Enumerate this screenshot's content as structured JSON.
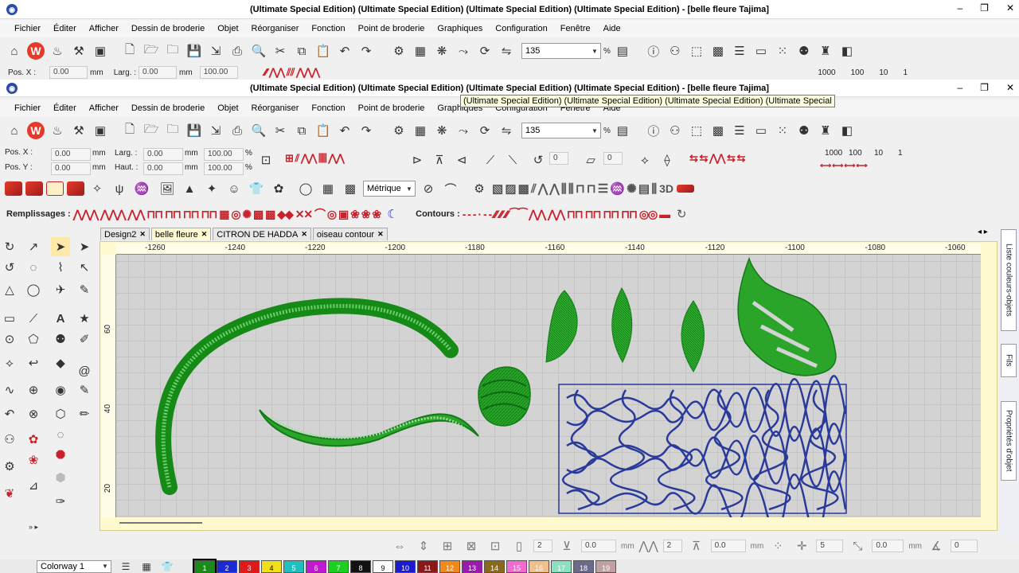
{
  "window": {
    "title": "(Ultimate Special Edition) (Ultimate Special Edition) (Ultimate Special Edition) (Ultimate Special Edition) - [belle fleure        Tajima]",
    "title2": "(Ultimate Special Edition) (Ultimate Special Edition) (Ultimate Special Edition) (Ultimate Special Edition) - [belle fleure        Tajima]",
    "minimize": "–",
    "restore": "❐",
    "close": "✕"
  },
  "menu": [
    "Fichier",
    "Éditer",
    "Afficher",
    "Dessin de broderie",
    "Objet",
    "Réorganiser",
    "Fonction",
    "Point de broderie",
    "Graphiques",
    "Configuration",
    "Fenêtre",
    "Aide"
  ],
  "toolbar": {
    "zoom": "135",
    "percent": "%",
    "units": "Métrique"
  },
  "position": {
    "pos_x_label": "Pos. X :",
    "pos_x": "0.00",
    "pos_y_label": "Pos. Y :",
    "pos_y": "0.00",
    "unit": "mm",
    "larg_label": "Larg. :",
    "larg": "0.00",
    "haut_label": "Haut. :",
    "haut": "0.00",
    "scale_x": "100.00",
    "scale_y": "100.00",
    "pct": "%",
    "rot1": "0",
    "rot2": "0"
  },
  "numbers": {
    "n1000": "1000",
    "n100": "100",
    "n10": "10",
    "n1": "1"
  },
  "fill_bar": {
    "remplissages": "Remplissages :",
    "contours": "Contours :"
  },
  "tabs": [
    {
      "label": "Design2"
    },
    {
      "label": "belle fleure"
    },
    {
      "label": "CITRON DE HADDA"
    },
    {
      "label": "oiseau contour"
    }
  ],
  "ruler": {
    "h": [
      "-1260",
      "-1240",
      "-1220",
      "-1200",
      "-1180",
      "-1160",
      "-1140",
      "-1120",
      "-1100",
      "-1080",
      "-1060"
    ],
    "v": [
      "60",
      "40",
      "20"
    ]
  },
  "tooltip": "(Ultimate Special Edition) (Ultimate Special Edition) (Ultimate Special Edition) (Ultimate Special",
  "right_panel": {
    "colors_tab": "Liste couleurs-objets",
    "threads_tab": "Fils",
    "props_tab": "Propriétés d'objet"
  },
  "bottom": {
    "v2": "2",
    "v00": "0.0",
    "mm": "mm",
    "v2b": "2",
    "v00b": "0.0",
    "mm2": "mm",
    "v5": "5",
    "v00c": "0.0",
    "mm3": "mm",
    "v0": "0"
  },
  "colorway": "Colorway 1",
  "palette": [
    {
      "n": "1",
      "c": "#1a8a1a"
    },
    {
      "n": "2",
      "c": "#1a2bd6"
    },
    {
      "n": "3",
      "c": "#e01a1a"
    },
    {
      "n": "4",
      "c": "#f0e01a"
    },
    {
      "n": "5",
      "c": "#20c0c0"
    },
    {
      "n": "6",
      "c": "#c01ad0"
    },
    {
      "n": "7",
      "c": "#1ad020"
    },
    {
      "n": "8",
      "c": "#111111"
    },
    {
      "n": "9",
      "c": "#ffffff"
    },
    {
      "n": "10",
      "c": "#1a1ad0"
    },
    {
      "n": "11",
      "c": "#8a1a1a"
    },
    {
      "n": "12",
      "c": "#f08a1a"
    },
    {
      "n": "13",
      "c": "#9a1ab0"
    },
    {
      "n": "14",
      "c": "#8a6a1a"
    },
    {
      "n": "15",
      "c": "#f06ad0"
    },
    {
      "n": "16",
      "c": "#f0c08a"
    },
    {
      "n": "17",
      "c": "#8ae0c0"
    },
    {
      "n": "18",
      "c": "#6a6a8a"
    },
    {
      "n": "19",
      "c": "#c0a0a0"
    }
  ],
  "colors": {
    "green": "#2aa52a",
    "darkgreen": "#0d6a14",
    "navy": "#2a3a9a",
    "accent_red": "#c8232c"
  }
}
